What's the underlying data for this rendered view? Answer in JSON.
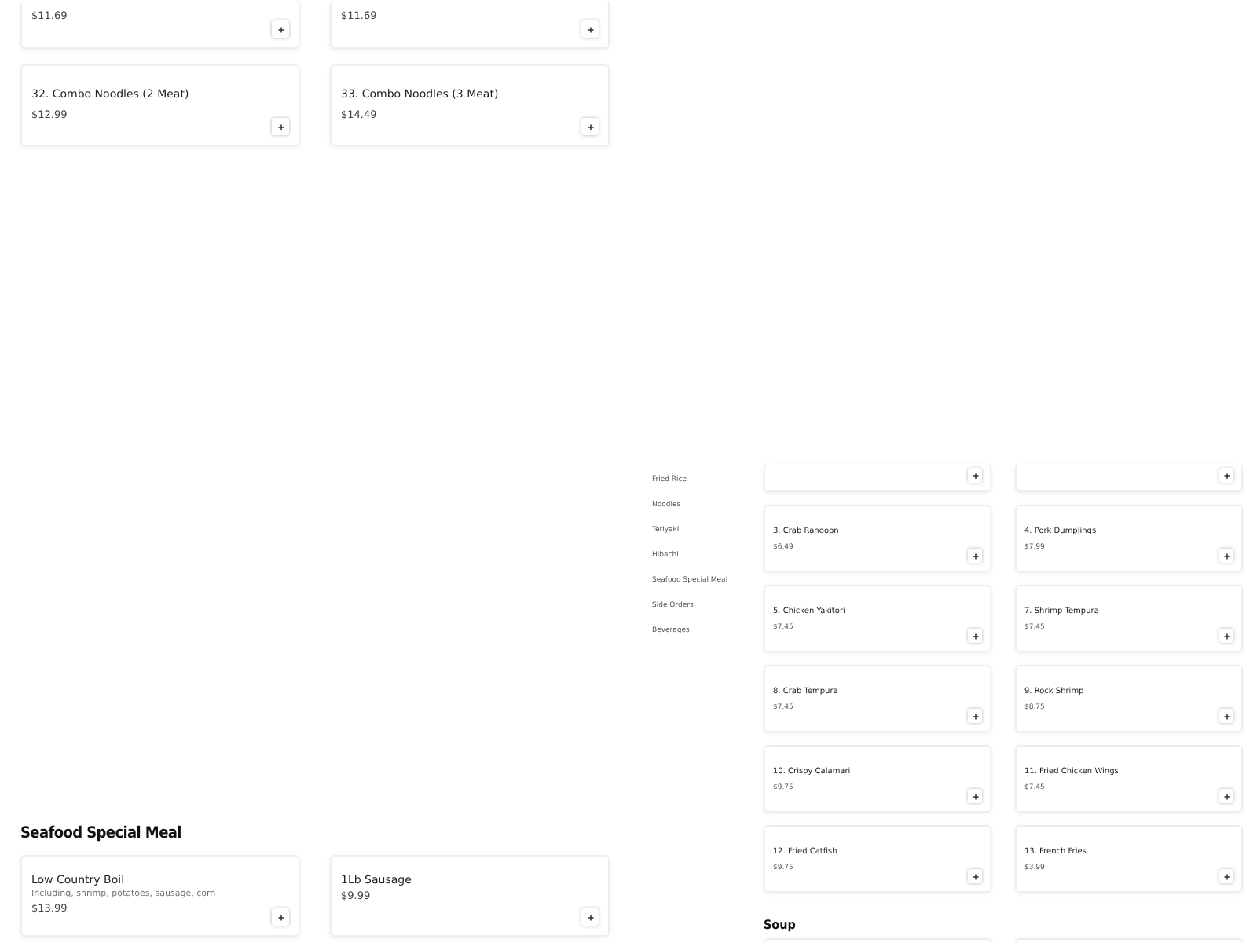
{
  "top_cards": [
    {
      "price": "$11.69"
    },
    {
      "price": "$11.69"
    },
    {
      "title": "32. Combo Noodles (2 Meat)",
      "price": "$12.99"
    },
    {
      "title": "33. Combo Noodles (3 Meat)",
      "price": "$14.49"
    }
  ],
  "seafood_section": {
    "heading": "Seafood Special Meal",
    "items": [
      {
        "title": "Low Country Boil",
        "description": "Including, shrimp, potatoes, sausage, corn",
        "price": "$13.99"
      },
      {
        "title": "1Lb Sausage",
        "price": "$9.99"
      }
    ]
  },
  "sidebar": {
    "items": [
      {
        "label": "Fried Rice"
      },
      {
        "label": "Noodles"
      },
      {
        "label": "Teriyaki"
      },
      {
        "label": "Hibachi"
      },
      {
        "label": "Seafood Special Meal"
      },
      {
        "label": "Side Orders"
      },
      {
        "label": "Beverages"
      }
    ]
  },
  "appetizer_cards": [
    {
      "title": "3. Crab Rangoon",
      "price": "$6.49"
    },
    {
      "title": "4. Pork Dumplings",
      "price": "$7.99"
    },
    {
      "title": "5. Chicken Yakitori",
      "price": "$7.45"
    },
    {
      "title": "7. Shrimp Tempura",
      "price": "$7.45"
    },
    {
      "title": "8. Crab Tempura",
      "price": "$7.45"
    },
    {
      "title": "9. Rock Shrimp",
      "price": "$8.75"
    },
    {
      "title": "10. Crispy Calamari",
      "price": "$9.75"
    },
    {
      "title": "11. Fried Chicken Wings",
      "price": "$7.45"
    },
    {
      "title": "12. Fried Catfish",
      "price": "$9.75"
    },
    {
      "title": "13. French Fries",
      "price": "$3.99"
    }
  ],
  "soup_section": {
    "heading": "Soup"
  }
}
